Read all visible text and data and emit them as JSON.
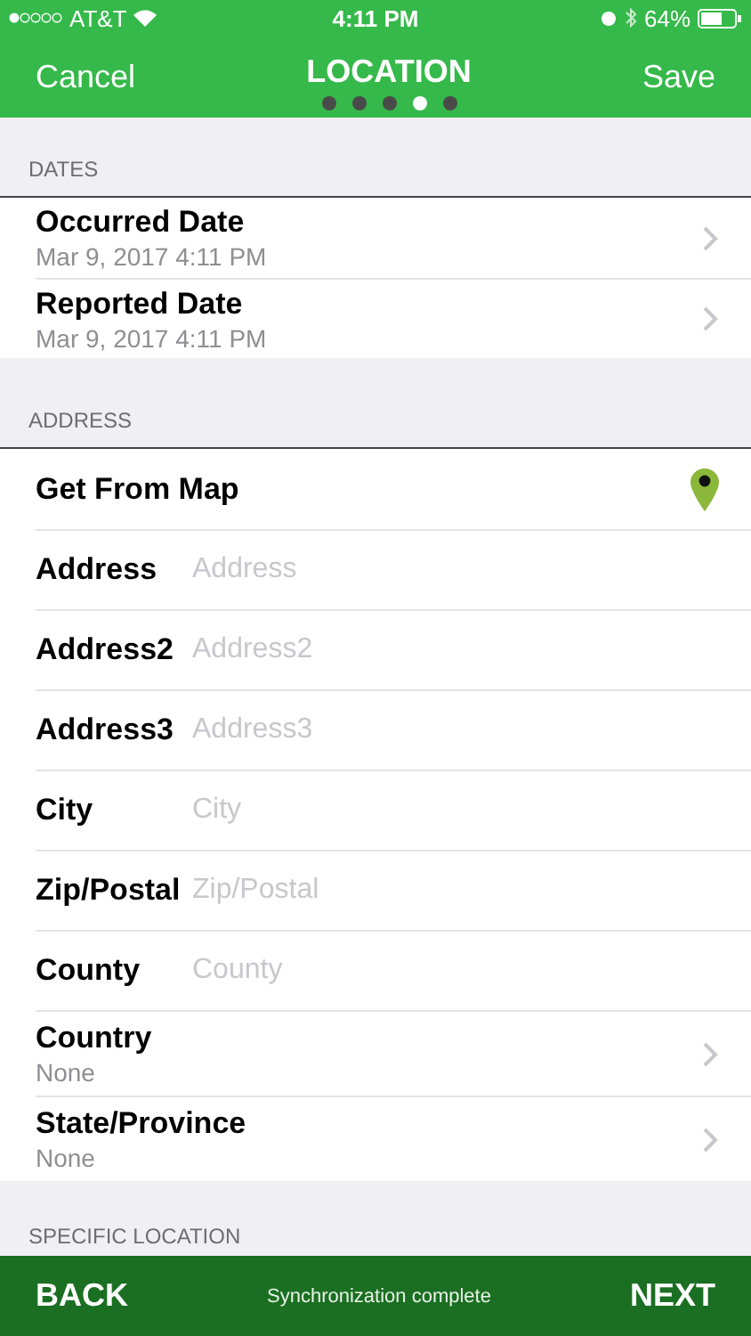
{
  "status_bar": {
    "carrier": "AT&T",
    "time": "4:11 PM",
    "battery": "64%"
  },
  "nav": {
    "left": "Cancel",
    "title": "LOCATION",
    "right": "Save"
  },
  "page_dots": [
    {
      "selected": false
    },
    {
      "selected": false
    },
    {
      "selected": false
    },
    {
      "selected": true
    },
    {
      "selected": false
    }
  ],
  "sections": [
    {
      "header": "DATES",
      "rows": [
        {
          "kind": "picker",
          "label": "Occurred Date",
          "value": "Mar 9, 2017 4:11 PM"
        },
        {
          "kind": "picker",
          "label": "Reported Date",
          "value": "Mar 9, 2017 4:11 PM"
        }
      ]
    },
    {
      "header": "ADDRESS",
      "rows": [
        {
          "kind": "map",
          "label": "Get From Map"
        },
        {
          "kind": "field",
          "label": "Address",
          "placeholder": "Address"
        },
        {
          "kind": "field",
          "label": "Address2",
          "placeholder": "Address2"
        },
        {
          "kind": "field",
          "label": "Address3",
          "placeholder": "Address3"
        },
        {
          "kind": "field",
          "label": "City",
          "placeholder": "City"
        },
        {
          "kind": "field",
          "label": "Zip/Postal",
          "placeholder": "Zip/Postal"
        },
        {
          "kind": "field",
          "label": "County",
          "placeholder": "County"
        },
        {
          "kind": "picker",
          "label": "Country",
          "value": "None"
        },
        {
          "kind": "picker",
          "label": "State/Province",
          "value": "None"
        }
      ]
    },
    {
      "header": "SPECIFIC LOCATION"
    }
  ],
  "bottom_bar": {
    "back": "BACK",
    "status": "Synchronization complete",
    "next": "NEXT"
  }
}
